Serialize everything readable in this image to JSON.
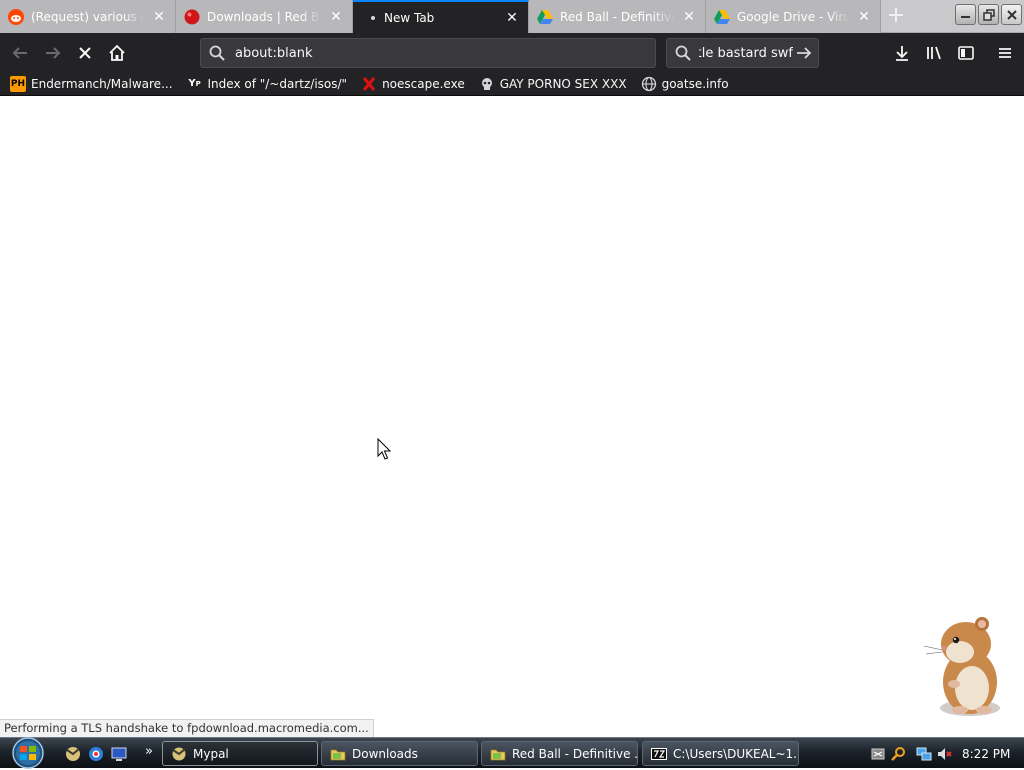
{
  "tabs": [
    {
      "title": "(Request) various Adobe",
      "favicon": "reddit-icon",
      "active": false
    },
    {
      "title": "Downloads | Red Ball",
      "favicon": "red-ball-icon",
      "active": false
    },
    {
      "title": "New Tab",
      "favicon": "loading-dot-icon",
      "active": true
    },
    {
      "title": "Red Ball - Definitive Edition",
      "favicon": "google-drive-icon",
      "active": false
    },
    {
      "title": "Google Drive - Virus scan",
      "favicon": "google-drive-icon",
      "active": false
    }
  ],
  "toolbar": {
    "new_tab": "+",
    "url": "about:blank",
    "search_text": "tle bastard swf"
  },
  "bookmarks": [
    {
      "label": "Endermanch/Malware...",
      "icon": "pornhub-icon"
    },
    {
      "label": "Index of \"/~dartz/isos/\"",
      "icon": "yp-icon"
    },
    {
      "label": "noescape.exe",
      "icon": "x-icon"
    },
    {
      "label": "GAY PORNO SEX XXX",
      "icon": "skull-icon"
    },
    {
      "label": "goatse.info",
      "icon": "globe-icon"
    }
  ],
  "status": "Performing a TLS handshake to fpdownload.macromedia.com...",
  "taskbar": {
    "windows": [
      {
        "label": "Mypal",
        "icon": "mypal-icon",
        "active": true
      },
      {
        "label": "Downloads",
        "icon": "folder-icon",
        "active": false
      },
      {
        "label": "Red Ball - Definitive ...",
        "icon": "folder-icon",
        "active": false
      },
      {
        "label": "C:\\Users\\DUKEAL~1...",
        "icon": "7zip-icon",
        "active": false
      }
    ],
    "clock": "8:22 PM",
    "overflow": "»"
  },
  "colors": {
    "accent": "#0a84ff",
    "toolbar": "#232325",
    "tabstrip": "#c9c9cb"
  }
}
